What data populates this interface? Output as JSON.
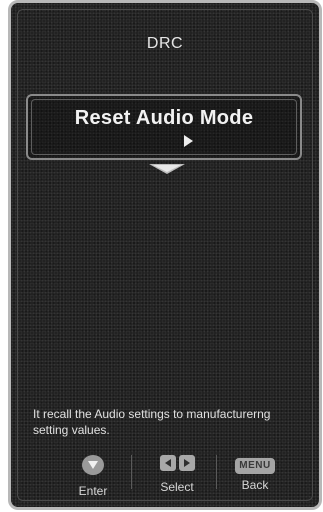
{
  "menu": {
    "previous_item": "DRC",
    "selected_item": "Reset Audio Mode"
  },
  "help_text": "It recall the Audio settings to manufacturerng setting values.",
  "footer": {
    "enter_label": "Enter",
    "select_label": "Select",
    "back_label": "Back",
    "menu_key_text": "MENU"
  },
  "icons": {
    "enter": "down-triangle-icon",
    "select_left": "left-arrow-icon",
    "select_right": "right-arrow-icon",
    "scroll": "scroll-down-arrow-icon",
    "cursor": "cursor-pointer-icon"
  }
}
